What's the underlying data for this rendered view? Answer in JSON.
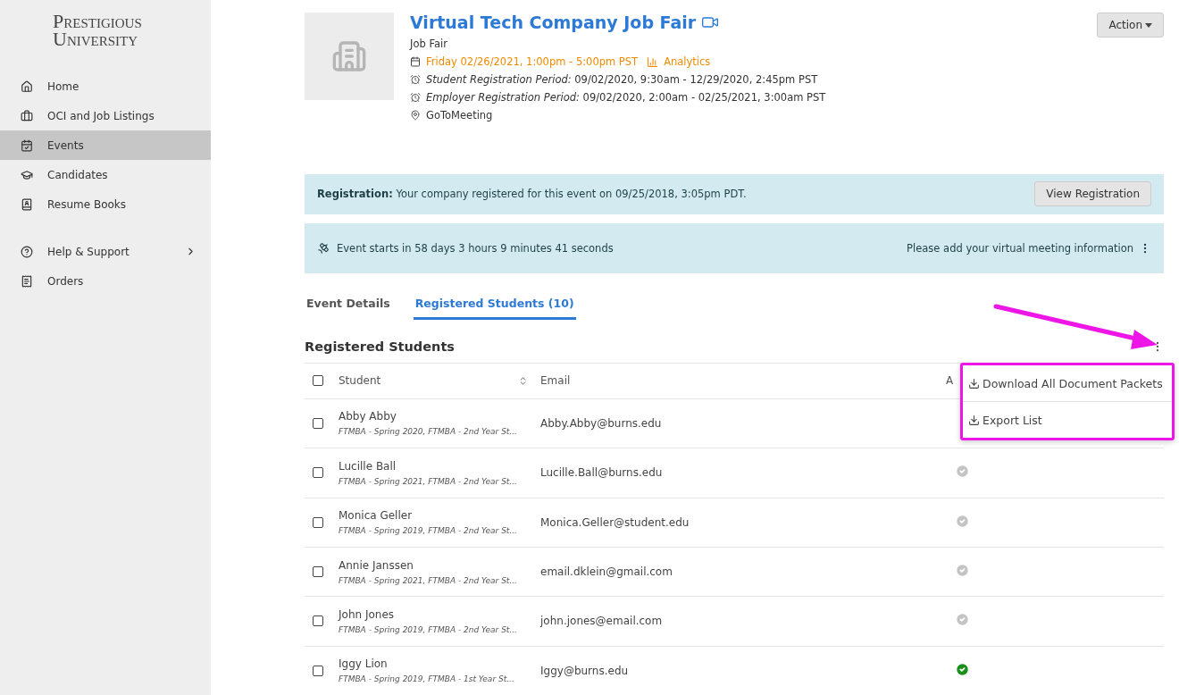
{
  "sidebar": {
    "logo_lines": [
      "Prestigious",
      "University"
    ],
    "items": [
      {
        "label": "Home",
        "selected": false,
        "has_submenu": false
      },
      {
        "label": "OCI and Job Listings",
        "selected": false,
        "has_submenu": false
      },
      {
        "label": "Events",
        "selected": true,
        "has_submenu": false
      },
      {
        "label": "Candidates",
        "selected": false,
        "has_submenu": false
      },
      {
        "label": "Resume Books",
        "selected": false,
        "has_submenu": false
      },
      {
        "label": "Help & Support",
        "selected": false,
        "has_submenu": true
      },
      {
        "label": "Orders",
        "selected": false,
        "has_submenu": false
      }
    ]
  },
  "event": {
    "title": "Virtual Tech Company Job Fair",
    "type": "Job Fair",
    "date": "Friday 02/26/2021, 1:00pm - 5:00pm PST",
    "analytics_link": "Analytics",
    "periods": [
      {
        "label": "Student Registration Period:",
        "value": "09/02/2020, 9:30am - 12/29/2020, 2:45pm PST"
      },
      {
        "label": "Employer Registration Period:",
        "value": "09/02/2020, 2:00am - 02/25/2021, 3:00am PST"
      }
    ],
    "location": "GoToMeeting",
    "action_button": "Action"
  },
  "registration_banner": {
    "text": "**Registration:** Your company registered for this event on 09/25/2018, 3:05pm PDT.",
    "button": "View Registration"
  },
  "countdown_banner": {
    "text": "Event starts in 58 days 3 hours 9 minutes 41 seconds",
    "link": "Please add your virtual meeting information"
  },
  "tabs": [
    {
      "label": "Event Details",
      "selected": false
    },
    {
      "label": "Registered Students (10)",
      "selected": true
    }
  ],
  "section_title": "Registered Students",
  "table": {
    "columns": [
      "Student",
      "Email",
      "A"
    ],
    "all_checked": false,
    "rows": [
      {
        "name": "Abby Abby",
        "programs": "FTMBA - Spring 2020, FTMBA - 2nd Year St...",
        "email": "Abby.Abby@burns.edu",
        "checked": false
      },
      {
        "name": "Lucille Ball",
        "programs": "FTMBA - Spring 2021, FTMBA - 2nd Year St...",
        "email": "Lucille.Ball@burns.edu",
        "checked": false,
        "attended": false
      },
      {
        "name": "Monica Geller",
        "programs": "FTMBA - Spring 2019, FTMBA - 2nd Year St...",
        "email": "Monica.Geller@student.edu",
        "checked": false,
        "attended": false
      },
      {
        "name": "Annie Janssen",
        "programs": "FTMBA - Spring 2021, FTMBA - 2nd Year St...",
        "email": "email.dklein@gmail.com",
        "checked": false,
        "attended": false
      },
      {
        "name": "John Jones",
        "programs": "FTMBA - Spring 2019, FTMBA - 2nd Year St...",
        "email": "john.jones@email.com",
        "checked": false,
        "attended": false
      },
      {
        "name": "Iggy Lion",
        "programs": "FTMBA - Spring 2019, FTMBA - 1st Year St...",
        "email": "Iggy@burns.edu",
        "checked": false,
        "attended": true
      }
    ]
  },
  "menu": {
    "items": [
      "Download All Document Packets",
      "Export List"
    ]
  }
}
